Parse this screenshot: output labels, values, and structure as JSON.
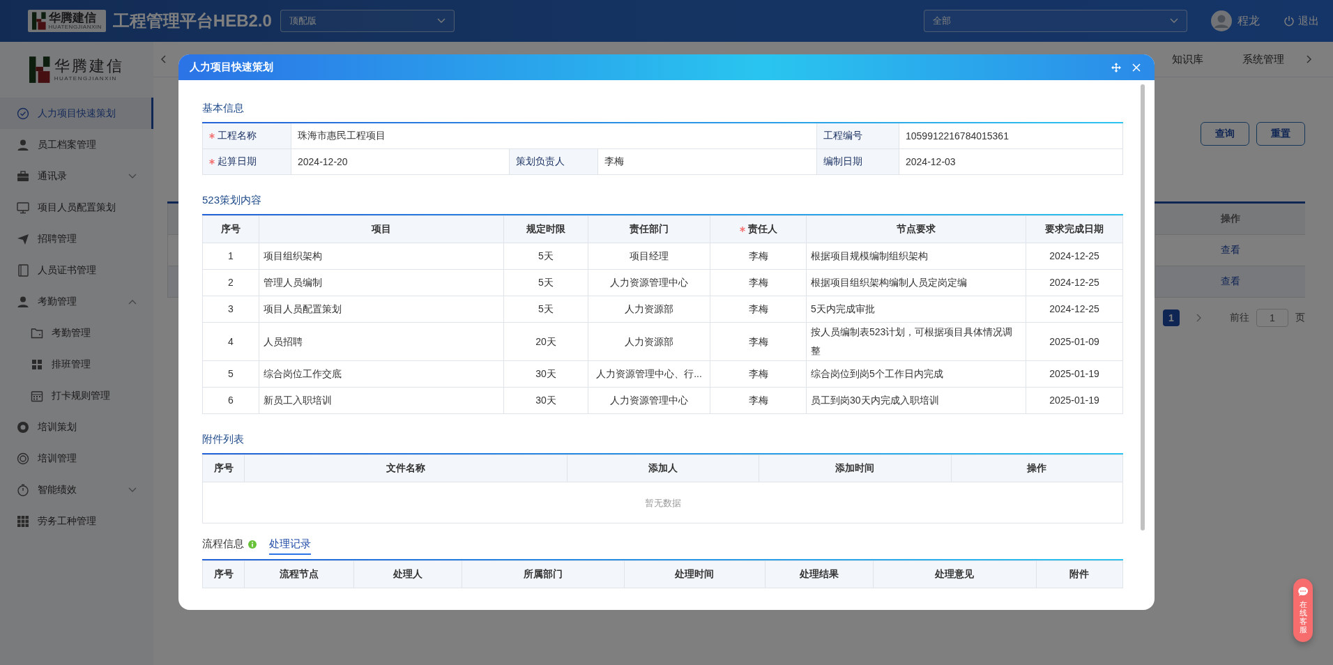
{
  "header": {
    "logo_text": "华腾建信",
    "logo_subtext": "HUATENGJIANXIN",
    "title": "工程管理平台HEB2.0",
    "edition_select": {
      "value": "顶配版"
    },
    "scope_select": {
      "value": "全部"
    },
    "user": "程龙",
    "logout": "退出"
  },
  "sidebar": {
    "logo_text": "华腾建信",
    "logo_subtext": "HUATENGJIANXIN",
    "items": [
      {
        "label": "人力项目快速策划",
        "kind": "link",
        "selected": true
      },
      {
        "label": "员工档案管理",
        "kind": "link",
        "selected": false
      },
      {
        "label": "通讯录",
        "kind": "group",
        "selected": false,
        "expanded": false
      },
      {
        "label": "项目人员配置策划",
        "kind": "link",
        "selected": false
      },
      {
        "label": "招聘管理",
        "kind": "link",
        "selected": false
      },
      {
        "label": "人员证书管理",
        "kind": "link",
        "selected": false
      },
      {
        "label": "考勤管理",
        "kind": "group",
        "selected": false,
        "expanded": true,
        "children": [
          {
            "label": "考勤管理",
            "kind": "link",
            "selected": false
          },
          {
            "label": "排班管理",
            "kind": "link",
            "selected": false
          },
          {
            "label": "打卡规则管理",
            "kind": "link",
            "selected": false
          }
        ]
      },
      {
        "label": "培训策划",
        "kind": "link",
        "selected": false
      },
      {
        "label": "培训管理",
        "kind": "link",
        "selected": false
      },
      {
        "label": "智能绩效",
        "kind": "group",
        "selected": false,
        "expanded": false
      },
      {
        "label": "劳务工种管理",
        "kind": "link",
        "selected": false
      }
    ]
  },
  "top_tabs": [
    "知识库",
    "系统管理"
  ],
  "background": {
    "buttons": [
      "查询",
      "重置"
    ],
    "table": {
      "columns": [
        "操作"
      ],
      "rows": [
        {
          "action": "查看"
        },
        {
          "action": "查看"
        }
      ]
    },
    "pagination": {
      "pages": [
        {
          "label": "1",
          "selected": true
        }
      ],
      "goto_label": "前往",
      "goto_value": "1",
      "page_suffix": "页"
    }
  },
  "dialog": {
    "title": "人力项目快速策划",
    "basic_info": {
      "title": "基本信息",
      "rows": [
        [
          {
            "kind": "field",
            "label": "工程名称",
            "required": true,
            "value": "珠海市惠民工程项目"
          },
          {
            "kind": "blank"
          },
          {
            "kind": "field",
            "label": "工程编号",
            "required": false,
            "value": "1059912216784015361"
          }
        ],
        [
          {
            "kind": "field",
            "label": "起算日期",
            "required": true,
            "value": "2024-12-20"
          },
          {
            "kind": "field",
            "label": "策划负责人",
            "required": false,
            "value": "李梅"
          },
          {
            "kind": "field",
            "label": "编制日期",
            "required": false,
            "value": "2024-12-03"
          }
        ]
      ]
    },
    "plan": {
      "title": "523策划内容",
      "columns": [
        {
          "label": "序号",
          "required": false
        },
        {
          "label": "项目",
          "required": false
        },
        {
          "label": "规定时限",
          "required": false
        },
        {
          "label": "责任部门",
          "required": false
        },
        {
          "label": "责任人",
          "required": true
        },
        {
          "label": "节点要求",
          "required": false
        },
        {
          "label": "要求完成日期",
          "required": false
        }
      ],
      "rows": [
        [
          "1",
          "项目组织架构",
          "5天",
          "项目经理",
          "李梅",
          "根据项目规模编制组织架构",
          "2024-12-25"
        ],
        [
          "2",
          "管理人员编制",
          "5天",
          "人力资源管理中心",
          "李梅",
          "根据项目组织架构编制人员定岗定编",
          "2024-12-25"
        ],
        [
          "3",
          "项目人员配置策划",
          "5天",
          "人力资源部",
          "李梅",
          "5天内完成审批",
          "2024-12-25"
        ],
        [
          "4",
          "人员招聘",
          "20天",
          "人力资源部",
          "李梅",
          "按人员编制表523计划，可根据项目具体情况调整",
          "2025-01-09"
        ],
        [
          "5",
          "综合岗位工作交底",
          "30天",
          "人力资源管理中心、行...",
          "李梅",
          "综合岗位到岗5个工作日内完成",
          "2025-01-19"
        ],
        [
          "6",
          "新员工入职培训",
          "30天",
          "人力资源管理中心",
          "李梅",
          "员工到岗30天内完成入职培训",
          "2025-01-19"
        ]
      ]
    },
    "attachments": {
      "title": "附件列表",
      "columns": [
        "序号",
        "文件名称",
        "添加人",
        "添加时间",
        "操作"
      ],
      "empty_text": "暂无数据"
    },
    "process": {
      "tabs": [
        {
          "label": "流程信息",
          "selected": false
        },
        {
          "label": "处理记录",
          "selected": true
        }
      ],
      "columns": [
        "序号",
        "流程节点",
        "处理人",
        "所属部门",
        "处理时间",
        "处理结果",
        "处理意见",
        "附件"
      ]
    }
  },
  "chat_widget": {
    "label": "在线客服"
  }
}
